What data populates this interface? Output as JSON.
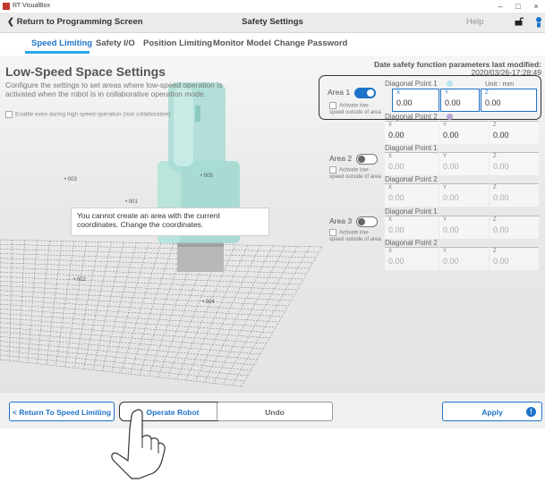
{
  "window": {
    "app_title": "RT VisualBox",
    "minimize": "–",
    "maximize": "□",
    "close": "×"
  },
  "nav": {
    "back_label": "Return to Programming Screen",
    "title": "Safety Settings",
    "help_label": "Help"
  },
  "tabs": [
    {
      "label": "Speed Limiting",
      "active": true
    },
    {
      "label": "Safety I/O",
      "active": false
    },
    {
      "label": "Position Limiting",
      "active": false
    },
    {
      "label": "Monitor Model",
      "active": false
    },
    {
      "label": "Change Password",
      "active": false
    }
  ],
  "panel": {
    "title": "Low-Speed Space Settings",
    "description": "Configure the settings to set areas where low-speed operation is activated when the robot is in collaborative operation mode.",
    "high_speed_checkbox": "Enable even during high speed operation (non collaborative)",
    "message": "You cannot create an area with the current coordinates. Change the coordinates.",
    "point_labels": [
      "003",
      "005",
      "001",
      "002",
      "004"
    ]
  },
  "modified": {
    "label": "Date safety function parameters last modified:",
    "date": "2020/03/26-17:28:49",
    "unit": "Unit : mm"
  },
  "areas": [
    {
      "label": "Area 1",
      "enabled": true,
      "activate_label": "Activate low-speed outside of area",
      "points": [
        {
          "label": "Diagonal Point 1",
          "dot_color": "#b9e3ec",
          "x": "0.00",
          "y": "0.00",
          "z": "0.00"
        },
        {
          "label": "Diagonal Point 2",
          "dot_color": "#b8a4d6",
          "x": "0.00",
          "y": "0.00",
          "z": "0.00"
        }
      ]
    },
    {
      "label": "Area 2",
      "enabled": false,
      "activate_label": "Activate low-speed outside of area",
      "points": [
        {
          "label": "Diagonal Point 1",
          "x": "0.00",
          "y": "0.00",
          "z": "0.00"
        },
        {
          "label": "Diagonal Point 2",
          "x": "0.00",
          "y": "0.00",
          "z": "0.00"
        }
      ]
    },
    {
      "label": "Area 3",
      "enabled": false,
      "activate_label": "Activate low-speed outside of area",
      "points": [
        {
          "label": "Diagonal Point 1",
          "x": "0.00",
          "y": "0.00",
          "z": "0.00"
        },
        {
          "label": "Diagonal Point 2",
          "x": "0.00",
          "y": "0.00",
          "z": "0.00"
        }
      ]
    }
  ],
  "axis_labels": {
    "x": "X",
    "y": "Y",
    "z": "Z"
  },
  "bottom": {
    "return_label": "< Return To Speed Limiting",
    "operate_label": "Operate Robot",
    "undo_label": "Undo",
    "apply_label": "Apply",
    "apply_badge": "!"
  },
  "colors": {
    "accent": "#1e73c8",
    "robot": "#9fd8cf"
  }
}
